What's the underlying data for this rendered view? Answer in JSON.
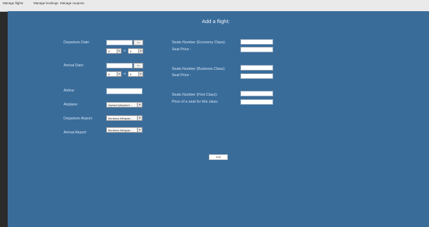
{
  "menu": {
    "items": [
      {
        "label": "Manage flights"
      },
      {
        "label": "Manage bookings"
      },
      {
        "label": "Manage coupons"
      }
    ]
  },
  "form": {
    "title": "Add a flight:",
    "departure_date_label": "Departure Date:",
    "departure_hour": "0",
    "departure_minute": "0",
    "arrival_date_label": "Arrival Date:",
    "arrival_hour": "0",
    "arrival_minute": "0",
    "hour_sep": "H",
    "airline_label": "Airline:",
    "airline_value": "",
    "airplane_label": "Airplane:",
    "airplane_value": "Airplane1|Airplane1 ...",
    "departure_airport_label": "Departure Airport:",
    "departure_airport_value": "Bordeaux-Mérignac ...",
    "arrival_airport_label": "Arrival Airport:",
    "arrival_airport_value": "Bordeaux-Mérignac ...",
    "seats_economy_label": "Seats Number (Economy Class):",
    "seat_price_label_1": "Seat Price :",
    "seats_business_label": "Seats Number (Business Class):",
    "seat_price_label_2": "Seat Price :",
    "seats_first_label": "Seats Number (First Class):",
    "price_first_label": "Price of a seat for this class:",
    "add_label": "Add",
    "calendar_glyph": "▭",
    "arrow_glyph": "▾"
  },
  "colors": {
    "panel": "#3a6c9a",
    "label_text": "#d3e3f3"
  }
}
